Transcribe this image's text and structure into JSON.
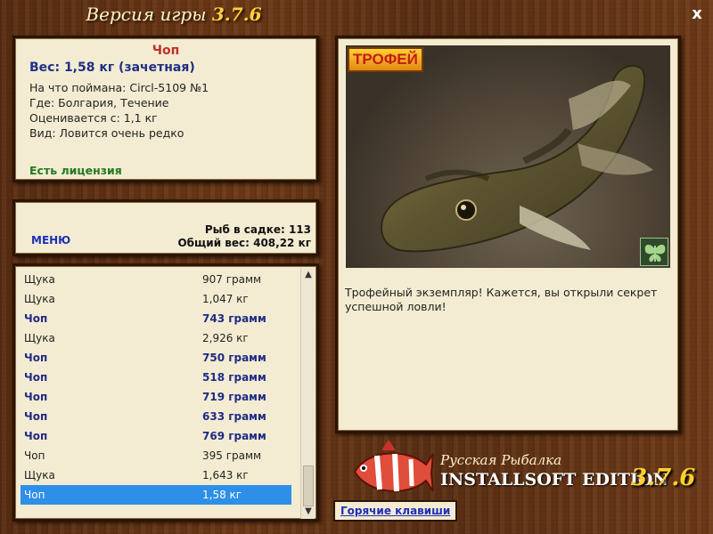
{
  "window": {
    "title": "Версия игры",
    "title_version": "3.7.6",
    "close_label": "x"
  },
  "catch": {
    "name": "Чоп",
    "weight": "Вес: 1,58 кг (зачетная)",
    "bait": "На что поймана: Circl-5109 №1",
    "place": "Где: Болгария, Течение",
    "rated_from": "Оценивается с: 1,1 кг",
    "type": "Вид: Ловится очень редко",
    "license": "Есть лицензия"
  },
  "stats": {
    "menu_label": "МЕНЮ",
    "fish_in_keepnet": "Рыб в садке: 113",
    "total_weight": "Общий вес: 408,22 кг"
  },
  "list": {
    "rows": [
      {
        "name": "Щука",
        "weight": "907 грамм",
        "chop": false
      },
      {
        "name": "Щука",
        "weight": "1,047 кг",
        "chop": false
      },
      {
        "name": "Чоп",
        "weight": "743 грамм",
        "chop": true
      },
      {
        "name": "Щука",
        "weight": "2,926 кг",
        "chop": false
      },
      {
        "name": "Чоп",
        "weight": "750 грамм",
        "chop": true
      },
      {
        "name": "Чоп",
        "weight": "518 грамм",
        "chop": true
      },
      {
        "name": "Чоп",
        "weight": "719 грамм",
        "chop": true
      },
      {
        "name": "Чоп",
        "weight": "633 грамм",
        "chop": true
      },
      {
        "name": "Чоп",
        "weight": "769 грамм",
        "chop": true
      },
      {
        "name": "Чоп",
        "weight": "395 грамм",
        "chop": false
      },
      {
        "name": "Щука",
        "weight": "1,643 кг",
        "chop": false
      },
      {
        "name": "Чоп",
        "weight": "1,58 кг",
        "chop": false,
        "selected": true
      }
    ],
    "scroll_up_icon": "chevron-up-icon",
    "scroll_down_icon": "chevron-down-icon"
  },
  "photo": {
    "badge": "ТРОФЕЙ",
    "butterfly_icon": "butterfly-icon",
    "description": "Трофейный экземпляр! Кажется, вы открыли секрет успешной ловли!"
  },
  "branding": {
    "line1": "Русская Рыбалка",
    "line2": "INSTALLSOFT EDITION",
    "version": "3.7.6"
  },
  "hotkeys_label": "Горячие клавиши",
  "colors": {
    "accent_blue": "#1e2fb8",
    "chop_blue": "#1f2b85",
    "name_red": "#c0302a",
    "license_green": "#237a1f",
    "selection": "#2d8fe8"
  }
}
